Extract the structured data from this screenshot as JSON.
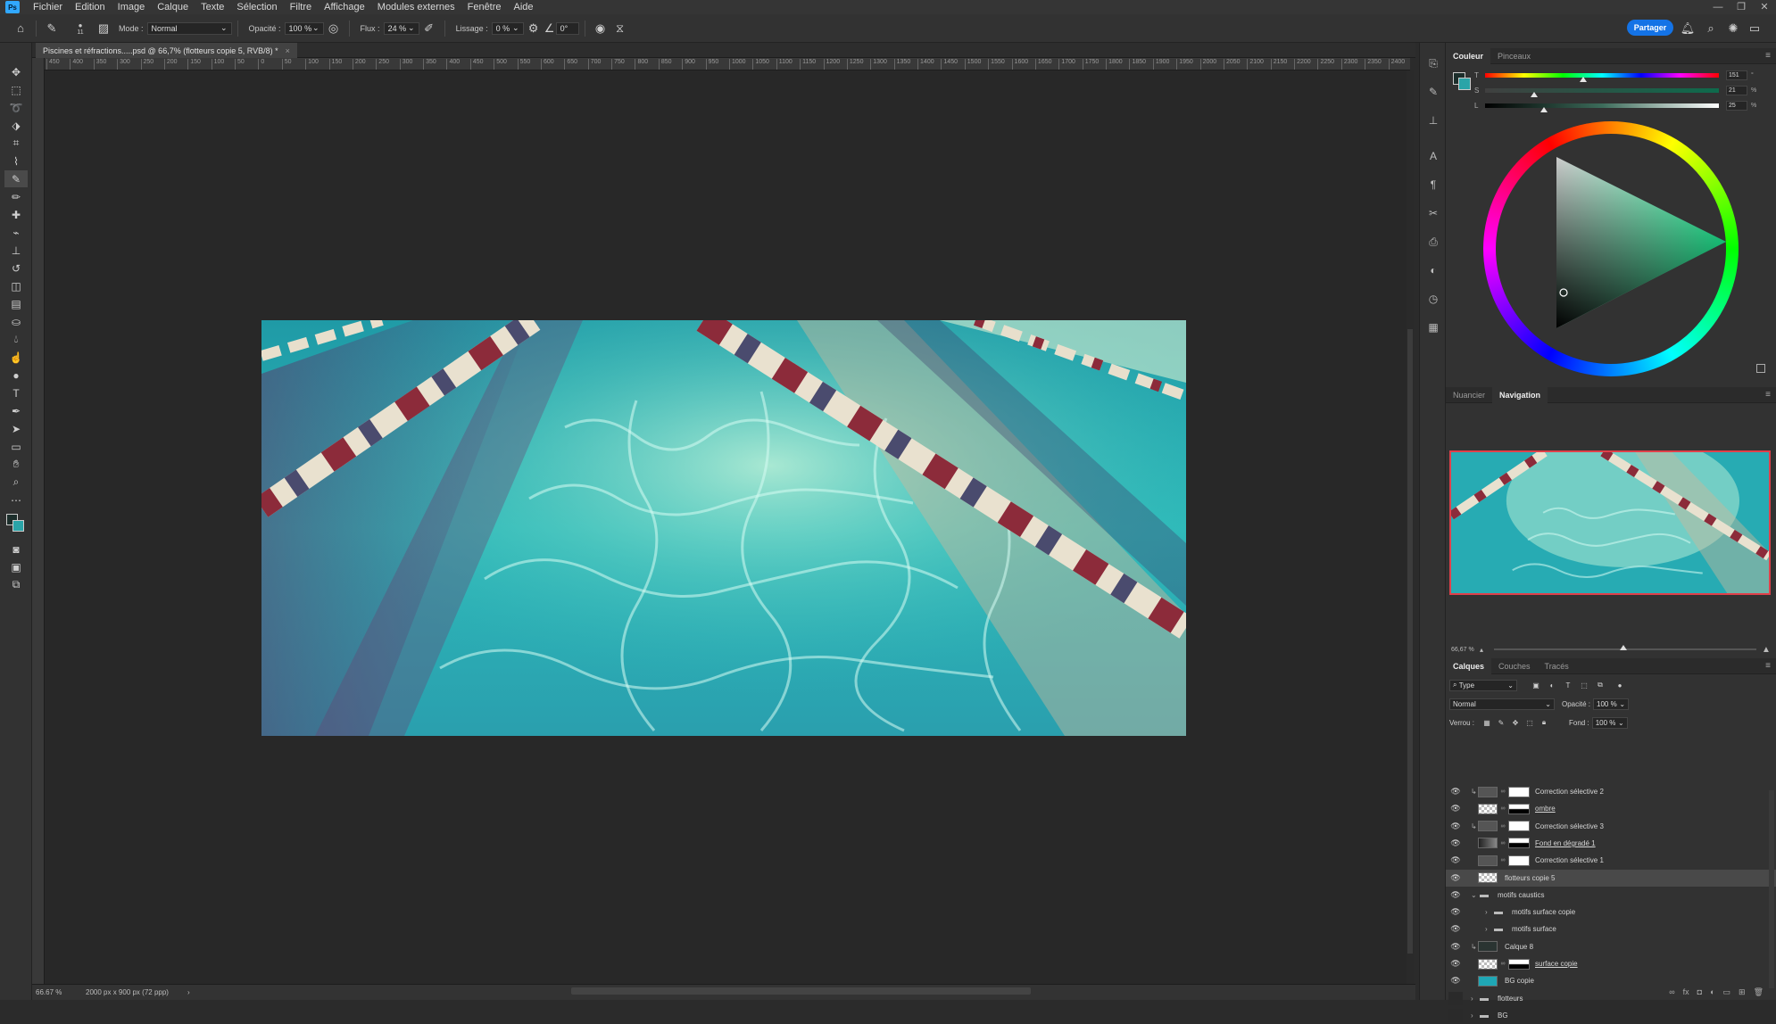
{
  "app": {
    "logo": "Ps"
  },
  "menu": [
    "Fichier",
    "Edition",
    "Image",
    "Calque",
    "Texte",
    "Sélection",
    "Filtre",
    "Affichage",
    "Modules externes",
    "Fenêtre",
    "Aide"
  ],
  "window_controls": [
    "—",
    "❐",
    "✕"
  ],
  "options": {
    "brush_size": "11",
    "mode_label": "Mode :",
    "mode_value": "Normal",
    "opacity_label": "Opacité :",
    "opacity_value": "100 %",
    "flow_label": "Flux :",
    "flow_value": "24 %",
    "smoothing_label": "Lissage :",
    "smoothing_value": "0 %",
    "angle_value": "0°",
    "share_label": "Partager"
  },
  "document": {
    "tab_title": "Piscines et réfractions.....psd @ 66,7% (flotteurs copie 5, RVB/8) *",
    "tab_close": "×",
    "ruler_ticks": [
      "450",
      "400",
      "350",
      "300",
      "250",
      "200",
      "150",
      "100",
      "50",
      "0",
      "50",
      "100",
      "150",
      "200",
      "250",
      "300",
      "350",
      "400",
      "450",
      "500",
      "550",
      "600",
      "650",
      "700",
      "750",
      "800",
      "850",
      "900",
      "950",
      "1000",
      "1050",
      "1100",
      "1150",
      "1200",
      "1250",
      "1300",
      "1350",
      "1400",
      "1450",
      "1500",
      "1550",
      "1600",
      "1650",
      "1700",
      "1750",
      "1800",
      "1850",
      "1900",
      "1950",
      "2000",
      "2050",
      "2100",
      "2150",
      "2200",
      "2250",
      "2300",
      "2350",
      "2400"
    ]
  },
  "status": {
    "zoom": "66.67 %",
    "doc_info": "2000 px x 900 px (72 ppp)",
    "arrow": "›"
  },
  "color_panel": {
    "tabs": [
      "Couleur",
      "Pinceaux"
    ],
    "active_tab": "Couleur",
    "sliders": [
      {
        "label": "T",
        "value": "151",
        "unit": "°",
        "level": 0.42
      },
      {
        "label": "S",
        "value": "21",
        "unit": "%",
        "level": 0.21
      },
      {
        "label": "L",
        "value": "25",
        "unit": "%",
        "level": 0.25
      }
    ]
  },
  "nav_panel": {
    "tabs": [
      "Nuancier",
      "Navigation"
    ],
    "active_tab": "Navigation",
    "zoom": "66,67 %"
  },
  "layers_panel": {
    "tabs": [
      "Calques",
      "Couches",
      "Tracés"
    ],
    "active_tab": "Calques",
    "filter_label": "Type",
    "blend_mode": "Normal",
    "opacity_label": "Opacité :",
    "opacity_value": "100 %",
    "lock_label": "Verrou :",
    "fill_label": "Fond :",
    "fill_value": "100 %",
    "layers": [
      {
        "name": "Correction sélective 2",
        "kind": "adjust",
        "clip": true
      },
      {
        "name": "ombre",
        "kind": "pixel-mask",
        "underline": true
      },
      {
        "name": "Correction sélective 3",
        "kind": "adjust",
        "clip": true
      },
      {
        "name": "Fond en dégradé 1",
        "kind": "gradient",
        "underline": true
      },
      {
        "name": "Correction sélective 1",
        "kind": "adjust"
      },
      {
        "name": "flotteurs copie 5",
        "kind": "pixel",
        "selected": true
      },
      {
        "name": "motifs caustics",
        "kind": "group",
        "open": true
      },
      {
        "name": "motifs surface copie",
        "kind": "group",
        "indent": 1
      },
      {
        "name": "motifs surface",
        "kind": "group",
        "indent": 1
      },
      {
        "name": "Calque 8",
        "kind": "pixel-dark",
        "clip": true
      },
      {
        "name": "surface copie",
        "kind": "pixel-mask",
        "underline": true
      },
      {
        "name": "BG copie",
        "kind": "pixel-teal"
      },
      {
        "name": "flotteurs",
        "kind": "group",
        "hidden": true
      },
      {
        "name": "BG",
        "kind": "group",
        "hidden": true
      }
    ]
  },
  "colors": {
    "accent": "#1473e6",
    "teal": "#2bb7b8",
    "selection_red": "#e0404a"
  }
}
